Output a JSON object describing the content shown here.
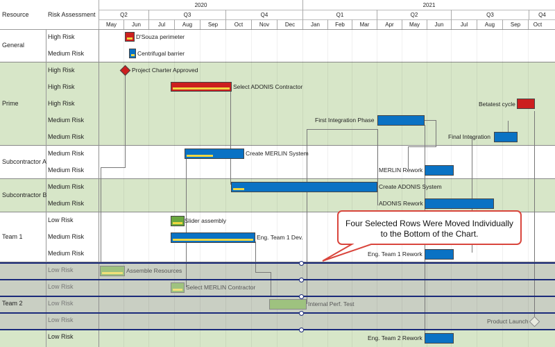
{
  "colors": {
    "red": "#cc1f1f",
    "blue": "#0a72c4",
    "green": "#6aa83f",
    "yellow": "#f0d640",
    "band": "#d7e6c8",
    "grey_band": "#c9cfc3",
    "select_line": "#1a2a7a"
  },
  "header": {
    "col_resource": "Resource",
    "col_risk": "Risk Assessment",
    "years": [
      "2020",
      "2021"
    ],
    "quarters": [
      "Q2",
      "Q3",
      "Q4",
      "Q1",
      "Q2",
      "Q3",
      "Q4"
    ],
    "months": [
      "May",
      "Jun",
      "Jul",
      "Aug",
      "Sep",
      "Oct",
      "Nov",
      "Dec",
      "Jan",
      "Feb",
      "Mar",
      "Apr",
      "May",
      "Jun",
      "Jul",
      "Aug",
      "Sep",
      "Oct"
    ]
  },
  "groups": [
    {
      "name": "General",
      "rows": [
        "High Risk",
        "Medium Risk"
      ]
    },
    {
      "name": "Prime",
      "rows": [
        "High Risk",
        "High Risk",
        "High Risk",
        "Medium Risk",
        "Medium Risk"
      ]
    },
    {
      "name": "Subcontractor A",
      "rows": [
        "Medium Risk",
        "Medium Risk"
      ]
    },
    {
      "name": "Subcontractor B",
      "rows": [
        "Medium Risk",
        "Medium Risk"
      ]
    },
    {
      "name": "Team 1",
      "rows": [
        "Low Risk",
        "Medium Risk",
        "Medium Risk"
      ]
    },
    {
      "name": "Team 2",
      "rows": [
        "Low Risk",
        "Low Risk",
        "Low Risk",
        "Low Risk",
        "Low Risk"
      ]
    }
  ],
  "tasks": {
    "dsouza": "D'Souza perimeter",
    "centrifugal": "Centrifugal barrier",
    "charter": "Project Charter Approved",
    "adonis_contractor": "Select ADONIS Contractor",
    "betatest": "Betatest cycle",
    "first_integration": "First Integration Phase",
    "final_integration": "Final Integration",
    "merlin_system": "Create MERLIN System",
    "merlin_rework": "MERLIN Rework",
    "adonis_system": "Create ADONIS System",
    "adonis_rework": "ADONIS Rework",
    "slider": "Slider assembly",
    "eng_team1_dev": "Eng. Team 1 Dev.",
    "eng_team1_rework": "Eng. Team 1 Rework",
    "assemble": "Assemble Resources",
    "merlin_contractor": "Select MERLIN Contractor",
    "internal_perf": "Internal Perf. Test",
    "product_launch": "Product Launch",
    "eng_team2_rework": "Eng. Team 2 Rework"
  },
  "callout": "Four Selected Rows Were Moved Individually to the Bottom of the Chart."
}
